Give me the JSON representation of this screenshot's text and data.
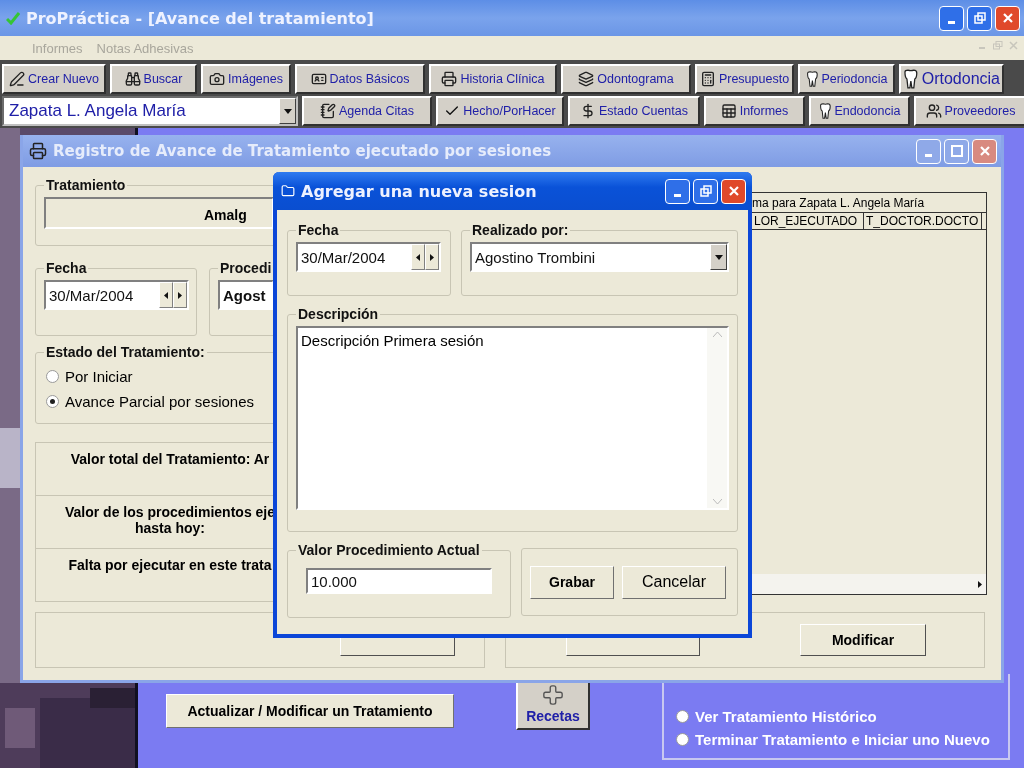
{
  "window": {
    "title": "ProPráctica - [Avance del tratamiento]"
  },
  "menu": [
    {
      "label": "Informes",
      "disabled": true
    },
    {
      "label": "Notas Adhesivas",
      "disabled": true
    }
  ],
  "toolbar": {
    "row_1": [
      {
        "label": "Crear Nuevo",
        "kind": "normal"
      },
      {
        "label": "Buscar",
        "kind": "normal"
      },
      {
        "label": "Imágenes",
        "kind": "normal"
      },
      {
        "label": "Datos Básicos",
        "kind": "normal"
      },
      {
        "label": "Historia Clínica",
        "kind": "normal"
      },
      {
        "label": "Odontograma",
        "kind": "normal"
      },
      {
        "label": "Presupuesto",
        "kind": "normal"
      },
      {
        "label": "Periodoncia",
        "kind": "normal"
      },
      {
        "label": "Ortodoncia",
        "kind": "large"
      }
    ],
    "patient": {
      "value": "Zapata L. Angela María"
    },
    "row_2": [
      {
        "label": "Agenda Citas"
      },
      {
        "label": "Hecho/PorHacer"
      },
      {
        "label": "Estado Cuentas"
      },
      {
        "label": "Informes"
      },
      {
        "label": "Endodoncia"
      },
      {
        "label": "Proveedores"
      }
    ]
  },
  "registro": {
    "title": "Registro de Avance de Tratamiento ejecutado por sesiones",
    "tratamiento": {
      "label": "Tratamiento",
      "value": "Amalg"
    },
    "fecha": {
      "label": "Fecha",
      "value": "30/Mar/2004"
    },
    "procedimiento": {
      "label": "Procedi",
      "value": "Agost"
    },
    "estado": {
      "label": "Estado del Tratamiento:",
      "options": [
        {
          "label": "Por Iniciar",
          "selected": false
        },
        {
          "label": "Avance Parcial por sesiones",
          "selected": true
        }
      ]
    },
    "valores": [
      {
        "lines": [
          "Valor total  del Tratamiento: Ar"
        ]
      },
      {
        "lines": [
          "Valor de los procedimientos eje",
          "hasta hoy:"
        ]
      },
      {
        "lines": [
          "Falta por ejecutar en este trata"
        ]
      }
    ],
    "grid": {
      "caption": "ma para Zapata L. Angela María",
      "columns": [
        "LOR_EJECUTADO",
        "T_DOCTOR.DOCTO"
      ]
    },
    "modify_button": "Modificar"
  },
  "dialog": {
    "title": "Agregar una nueva sesion",
    "fecha": {
      "label": "Fecha",
      "value": "30/Mar/2004"
    },
    "realizado": {
      "label": "Realizado por:",
      "value": "Agostino Trombini"
    },
    "descripcion": {
      "label": "Descripción",
      "value": "Descripción Primera sesión"
    },
    "valor": {
      "label": "Valor Procedimiento Actual",
      "value": "10.000"
    },
    "buttons": [
      {
        "label": "Grabar",
        "kind": "bold"
      },
      {
        "label": "Cancelar",
        "kind": "plain"
      }
    ]
  },
  "bottom": {
    "update_button": "Actualizar / Modificar un Tratamiento",
    "recetas": "Recetas",
    "options": [
      {
        "label": "Ver Tratamiento Histórico",
        "selected": false
      },
      {
        "label": "Terminar Tratamiento e Iniciar uno Nuevo",
        "selected": false
      }
    ]
  }
}
